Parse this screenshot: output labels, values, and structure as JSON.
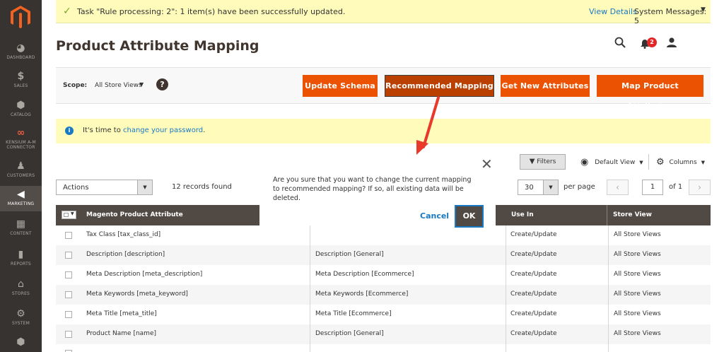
{
  "nav": {
    "items": [
      {
        "label": "DASHBOARD",
        "icon": "dashboard-icon",
        "glyph": "◕"
      },
      {
        "label": "SALES",
        "icon": "dollar-icon",
        "glyph": "$"
      },
      {
        "label": "CATALOG",
        "icon": "box-icon",
        "glyph": "⬢"
      },
      {
        "label": "KENSIUM A-M CONNECTOR",
        "line1": "KENSIUM A-M",
        "line2": "CONNECTOR",
        "icon": "connector-icon",
        "glyph": "∞"
      },
      {
        "label": "CUSTOMERS",
        "icon": "person-icon",
        "glyph": "♟"
      },
      {
        "label": "MARKETING",
        "icon": "megaphone-icon",
        "glyph": "◀"
      },
      {
        "label": "CONTENT",
        "icon": "content-icon",
        "glyph": "▦"
      },
      {
        "label": "REPORTS",
        "icon": "bar-chart-icon",
        "glyph": "▮"
      },
      {
        "label": "STORES",
        "icon": "store-icon",
        "glyph": "⌂"
      },
      {
        "label": "SYSTEM",
        "icon": "gear-icon",
        "glyph": "⚙"
      },
      {
        "label": "",
        "icon": "cube-icon",
        "glyph": "⬢"
      }
    ]
  },
  "message": {
    "text": "Task \"Rule processing: 2\": 1 item(s) have been successfully updated.",
    "view_details": "View Details",
    "system_messages": "System Messages: 5"
  },
  "header": {
    "title": "Product Attribute Mapping",
    "notifications_count": "2"
  },
  "scope": {
    "label": "Scope:",
    "value": "All Store Views",
    "help": "?"
  },
  "buttons": {
    "update_schema": "Update Schema",
    "recommended_mapping": "Recommended Mapping",
    "get_new_attributes": "Get New Attributes",
    "map_product_attributes": "Map Product Attributes"
  },
  "info": {
    "prefix": "It's time to ",
    "link": "change your password",
    "suffix": "."
  },
  "toolbar": {
    "filters": "Filters",
    "default_view": "Default View",
    "columns": "Columns",
    "actions": "Actions",
    "records": "12 records found",
    "per_page_value": "30",
    "per_page_label": "per page",
    "page": "1",
    "of_pages": "of 1"
  },
  "confirm": {
    "message": "Are you sure that you want to change the current mapping to recommended mapping? If so, all existing data will be deleted.",
    "cancel": "Cancel",
    "ok": "OK"
  },
  "table": {
    "headers": {
      "attribute": "Magento Product Attribute",
      "use_in": "Use In",
      "store_view": "Store View"
    },
    "rows": [
      {
        "attribute": "Tax Class [tax_class_id]",
        "mapped": "",
        "use_in": "Create/Update",
        "store_view": "All Store Views"
      },
      {
        "attribute": "Description [description]",
        "mapped": "Description [General]",
        "use_in": "Create/Update",
        "store_view": "All Store Views"
      },
      {
        "attribute": "Meta Description [meta_description]",
        "mapped": "Meta Description [Ecommerce]",
        "use_in": "Create/Update",
        "store_view": "All Store Views"
      },
      {
        "attribute": "Meta Keywords [meta_keyword]",
        "mapped": "Meta Keywords [Ecommerce]",
        "use_in": "Create/Update",
        "store_view": "All Store Views"
      },
      {
        "attribute": "Meta Title [meta_title]",
        "mapped": "Meta Title [Ecommerce]",
        "use_in": "Create/Update",
        "store_view": "All Store Views"
      },
      {
        "attribute": "Product Name [name]",
        "mapped": "Description [General]",
        "use_in": "Create/Update",
        "store_view": "All Store Views"
      }
    ]
  },
  "colors": {
    "accent": "#eb5202",
    "nav_bg": "#373330",
    "table_header": "#514943",
    "link": "#1979c3",
    "notice_bg": "#fffbbb",
    "annotation_arrow": "#e8392b"
  }
}
